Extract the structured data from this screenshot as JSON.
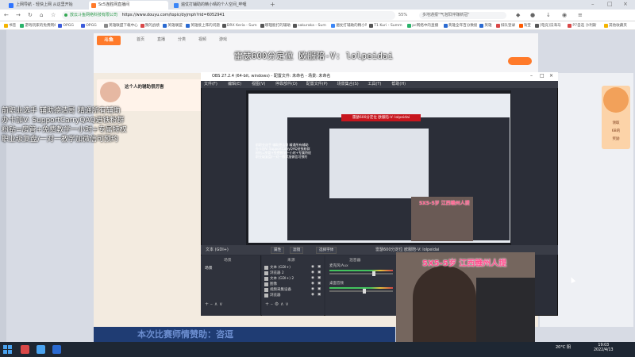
{
  "browser": {
    "tabs": [
      {
        "label": "上网导航 - 轻快上网 从这里开始",
        "color": "#2f74ff"
      },
      {
        "label": "Sc5连胜网直播间",
        "color": "#ff7a2a"
      },
      {
        "label": "遍仗打辅助的精小晴的个人空间_哔哩",
        "color": "#3b86f7"
      }
    ],
    "address": "https://www.douyu.com/topic/dyjmph?rid=6052941",
    "site_tag": "放云斗鱼网络科技有限公司",
    "zoom": "55%",
    "search_hint": "多地通报\"气泡阳伴赚新冠\"",
    "bookmarks": [
      {
        "label": "书签",
        "color": "#f4b400"
      },
      {
        "label": "游戏玩家的免费网站",
        "color": "#2ab36a"
      },
      {
        "label": "OPGG",
        "color": "#3b5bdb"
      },
      {
        "label": "OPGG",
        "color": "#3b5bdb"
      },
      {
        "label": "英雄联盟下载中心",
        "color": "#888"
      },
      {
        "label": "我的战绩",
        "color": "#d94848"
      },
      {
        "label": "英雄联盟",
        "color": "#2a6ad1"
      },
      {
        "label": "英雄接上阵的问题",
        "color": "#2a6ad1"
      },
      {
        "label": "DRX Keria - Sum",
        "color": "#555"
      },
      {
        "label": "哪理能打的辅助",
        "color": "#555"
      },
      {
        "label": "sakuraka - Sum",
        "color": "#555"
      },
      {
        "label": "遍仗打辅助的精小晴",
        "color": "#3b86f7"
      },
      {
        "label": "T1 Kuri - Summ",
        "color": "#555"
      },
      {
        "label": "pc网络中的直播",
        "color": "#2ab36a"
      },
      {
        "label": "英雄全年百分数据",
        "color": "#2a6ad1"
      },
      {
        "label": "英雄",
        "color": "#2a6ad1"
      },
      {
        "label": "排队登录",
        "color": "#d94848"
      },
      {
        "label": "淘宝",
        "color": "#ff5a00"
      },
      {
        "label": "[电竞]法海马",
        "color": "#555"
      },
      {
        "label": "P7自选 沙利斯",
        "color": "#d94848"
      },
      {
        "label": "其他收藏夹",
        "color": "#f4b400"
      }
    ]
  },
  "site": {
    "logo": "斗鱼",
    "menu": [
      "首页",
      "直播",
      "分类",
      "视频",
      "游戏"
    ],
    "streamer_title": "这个人的辅助很厉害",
    "promo_lines": [
      "领取",
      "6B的",
      "奖励"
    ]
  },
  "stream": {
    "title": "雷瑟600分定位 欧服陪-V: lolpeidai",
    "overlay_lines": [
      "前职业选手 辅助德洁哥 精通所有辅助",
      "办卡加V: SupportCarryQAQ进铁粉群",
      "粉钻=房管+免费教学一小时+专属特权",
      "职业级复盘/一对一教学加微信可预约"
    ],
    "banner": "本次比赛师情赞助：咨逗",
    "cam_label": "5X5-5岁 江西赣州人提",
    "inner_cam_label": "5X5-5岁 江西赣州人提"
  },
  "obs": {
    "title": "OBS 27.2.4 (64-bit, windows) - 配置文件: 未命名 - 场景: 未命名",
    "menu": [
      "文件(F)",
      "编辑(E)",
      "视图(V)",
      "停靠部件(D)",
      "配置文件(P)",
      "场景集合(S)",
      "工具(T)",
      "帮助(H)"
    ],
    "status": "文本 (GDI+)",
    "status_buttons": [
      "属性",
      "滤镜",
      "选择字体"
    ],
    "status_text": "雷瑟600分定位 欧服陪-V: lolpeidai",
    "panels": {
      "scenes": "场景",
      "sources": "来源",
      "mixer": "混音器"
    },
    "scene_item": "场景",
    "sources": [
      "文本 (GDI+)",
      "浏览器 2",
      "文本 (GDI+) 2",
      "图像",
      "视频采集设备",
      "浏览器"
    ],
    "mixer": [
      {
        "name": "麦克风/Aux",
        "level": 0.68
      },
      {
        "name": "桌面音频",
        "level": 0.52
      }
    ],
    "inner_red_text": "雷瑟600分定位 欧服陪-V: lolpeidai"
  },
  "taskbar": {
    "weather": "20°C 阴",
    "time": "19:03",
    "date": "2022/4/13",
    "app_colors": [
      "#d94848",
      "#4aa3f0",
      "#2a6ad1"
    ]
  }
}
